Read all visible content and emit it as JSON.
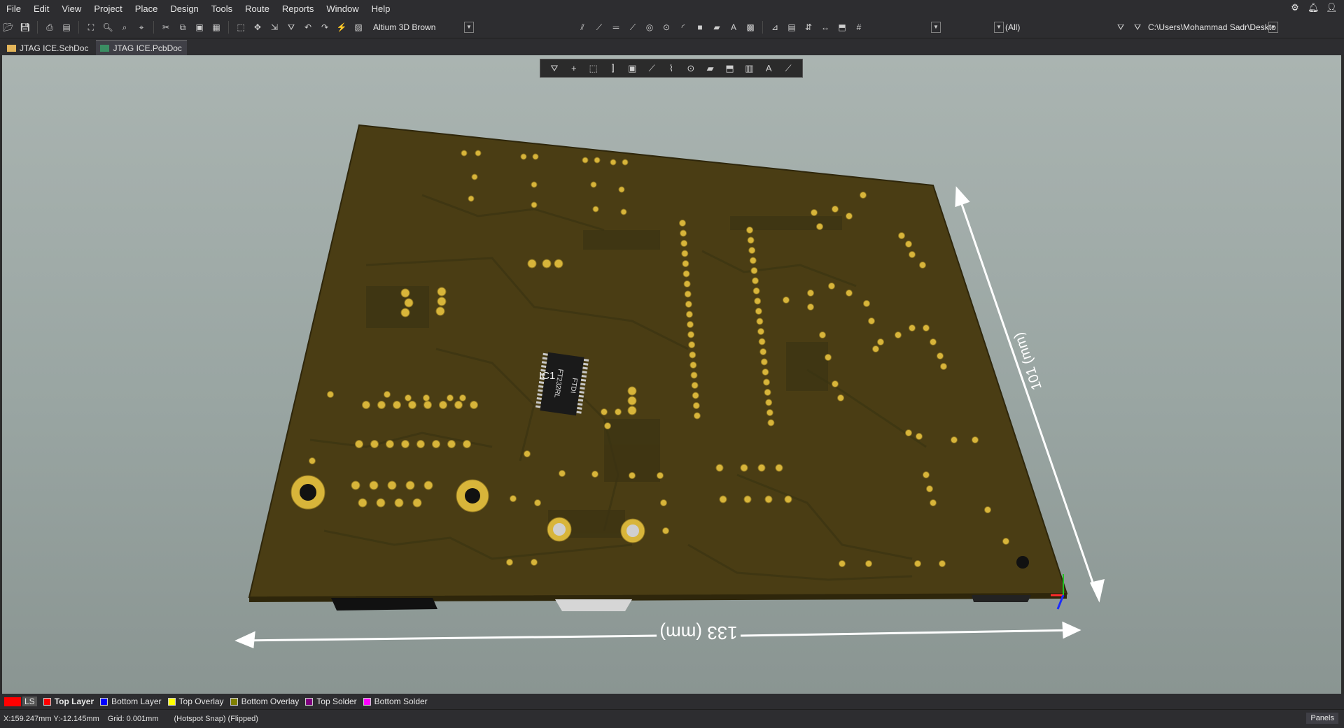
{
  "menu": [
    "File",
    "Edit",
    "View",
    "Project",
    "Place",
    "Design",
    "Tools",
    "Route",
    "Reports",
    "Window",
    "Help"
  ],
  "toolbar": {
    "view_config": "Altium 3D Brown",
    "filter_value": "(All)",
    "path": "C:\\Users\\Mohammad Sadr\\Deskto"
  },
  "tabs": [
    {
      "label": "JTAG ICE.SchDoc",
      "active": false
    },
    {
      "label": "JTAG ICE.PcbDoc",
      "active": true
    }
  ],
  "board": {
    "chip_label": "IC1",
    "chip_text_1": "FTDI",
    "chip_text_2": "FT232RL",
    "dim_width": "133 (mm)",
    "dim_height": "101 (mm)"
  },
  "layers": [
    {
      "name": "LS",
      "color": "#ff0000"
    },
    {
      "name": "Top Layer",
      "color": "#ff0000"
    },
    {
      "name": "Bottom Layer",
      "color": "#0000ff"
    },
    {
      "name": "Top Overlay",
      "color": "#ffff00"
    },
    {
      "name": "Bottom Overlay",
      "color": "#808000"
    },
    {
      "name": "Top Solder",
      "color": "#800080"
    },
    {
      "name": "Bottom Solder",
      "color": "#ff00ff"
    }
  ],
  "status": {
    "coords": "X:159.247mm Y:-12.145mm",
    "grid": "Grid: 0.001mm",
    "snap": "(Hotspot Snap) (Flipped)",
    "panels": "Panels"
  },
  "colors": {
    "board": "#4a3d14",
    "pad": "#d8b53a",
    "background_top": "#aab4b1",
    "background_bottom": "#8a9592"
  }
}
